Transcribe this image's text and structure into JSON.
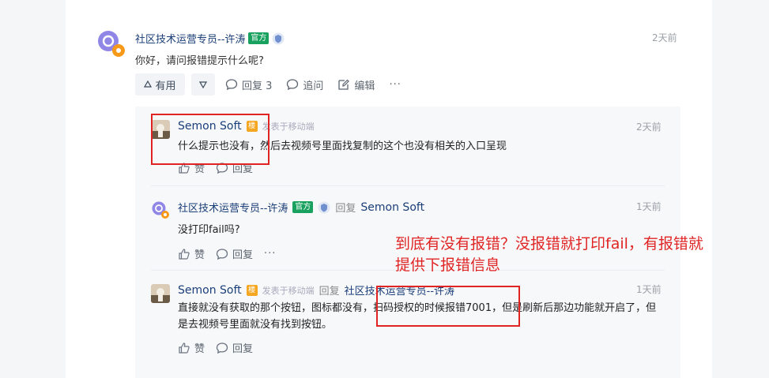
{
  "post": {
    "author": "社区技术运营专员--许涛",
    "official_badge": "官方",
    "time": "2天前",
    "text": "你好，请问报错提示什么呢?",
    "actions": {
      "useful": "有用",
      "reply": "回复 3",
      "follow_up": "追问",
      "edit": "编辑",
      "more": "···"
    }
  },
  "replies": [
    {
      "author": "Semon Soft",
      "host_badge": "楼",
      "meta": "发表于移动端",
      "time": "2天前",
      "text": "什么提示也没有，然后去视频号里面找复制的这个也没有相关的入口呈现",
      "like": "赞",
      "reply": "回复"
    },
    {
      "author": "社区技术运营专员--许涛",
      "official_badge": "官方",
      "reply_label": "回复",
      "reply_to": "Semon Soft",
      "time": "1天前",
      "text": "没打印fail吗?",
      "like": "赞",
      "reply": "回复",
      "more": "···"
    },
    {
      "author": "Semon Soft",
      "host_badge": "楼",
      "meta": "发表于移动端",
      "reply_label": "回复",
      "reply_to": "社区技术运营专员--许涛",
      "time": "1天前",
      "text": "直接就没有获取的那个按钮，图标都没有，扫码授权的时候报错7001，但是刷新后那边功能就开启了，但是去视频号里面就没有找到按钮。",
      "like": "赞",
      "reply": "回复"
    }
  ],
  "annotation": {
    "line1": "到底有没有报错？没报错就打印fail，有报错就",
    "line2": "提供下报错信息"
  },
  "colors": {
    "link_blue": "#1a3e78",
    "official_green": "#19a15f",
    "host_orange": "#f5a623",
    "annotation_red": "#e02424"
  }
}
